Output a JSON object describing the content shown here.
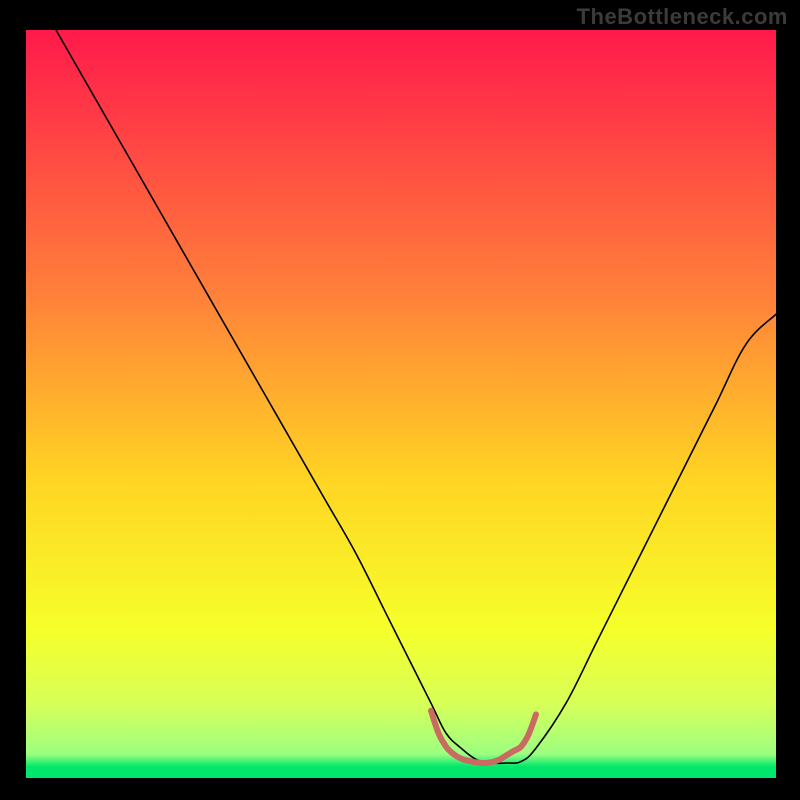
{
  "attribution": "TheBottleneck.com",
  "chart_data": {
    "type": "line",
    "title": "",
    "xlabel": "",
    "ylabel": "",
    "xlim": [
      0,
      100
    ],
    "ylim": [
      0,
      100
    ],
    "background_gradient": [
      {
        "stop": 0.0,
        "color": "#ff1a4b"
      },
      {
        "stop": 0.35,
        "color": "#ff7f3a"
      },
      {
        "stop": 0.6,
        "color": "#ffd423"
      },
      {
        "stop": 0.8,
        "color": "#f6ff2a"
      },
      {
        "stop": 0.9,
        "color": "#d7ff58"
      },
      {
        "stop": 0.968,
        "color": "#9cff80"
      },
      {
        "stop": 0.985,
        "color": "#00e86b"
      },
      {
        "stop": 1.0,
        "color": "#00e86b"
      }
    ],
    "series": [
      {
        "name": "curve",
        "stroke": "#000000",
        "stroke_width": 1.6,
        "x": [
          4,
          8,
          12,
          16,
          20,
          24,
          28,
          32,
          36,
          40,
          44,
          48,
          50,
          54,
          56,
          58,
          60,
          62,
          64,
          66,
          68,
          72,
          76,
          80,
          84,
          88,
          92,
          96,
          100
        ],
        "y": [
          100,
          93,
          86,
          79,
          72,
          65,
          58,
          51,
          44,
          37,
          30,
          22,
          18,
          10,
          6,
          4,
          2.5,
          2,
          2,
          2.2,
          4,
          10,
          18,
          26,
          34,
          42,
          50,
          58,
          62
        ]
      },
      {
        "name": "bottom-highlight",
        "stroke": "#c96a63",
        "stroke_width": 6,
        "x": [
          54,
          55,
          56,
          57,
          58,
          59,
          60,
          61,
          62,
          63,
          64,
          65,
          66,
          67,
          68
        ],
        "y": [
          9,
          6,
          4.2,
          3.2,
          2.6,
          2.3,
          2.1,
          2.0,
          2.1,
          2.4,
          3.0,
          3.6,
          4.2,
          5.8,
          8.5
        ]
      }
    ]
  }
}
